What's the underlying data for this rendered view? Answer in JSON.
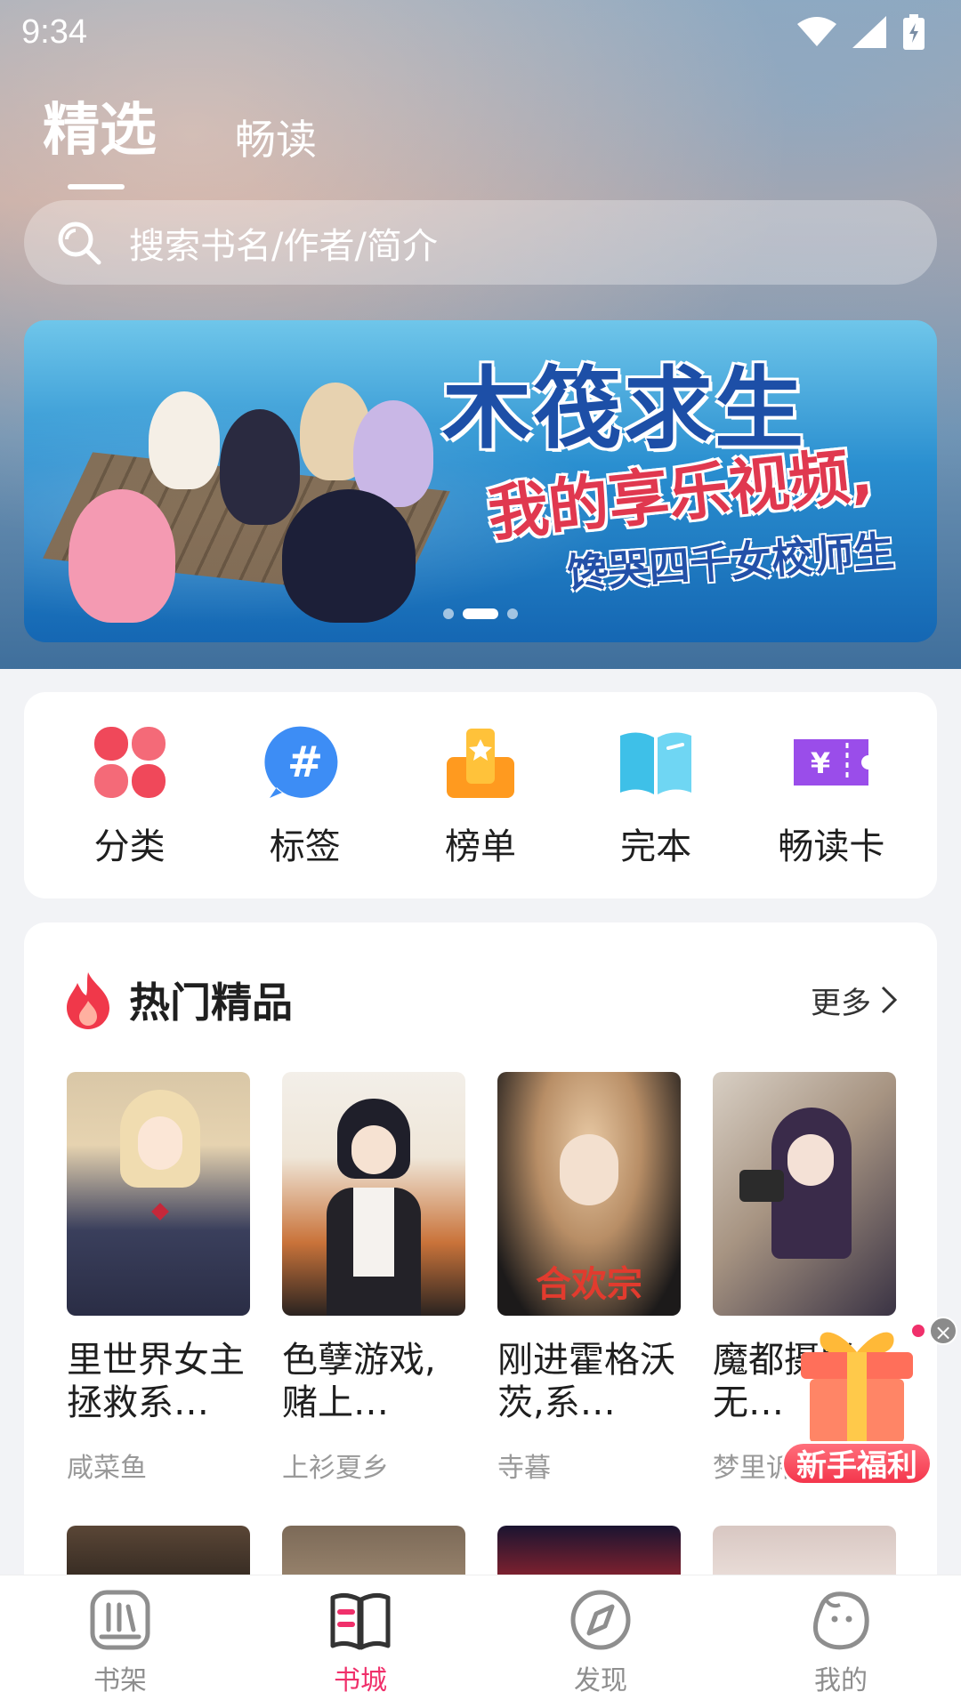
{
  "status_bar": {
    "time": "9:34"
  },
  "top_tabs": [
    {
      "label": "精选",
      "active": true
    },
    {
      "label": "畅读",
      "active": false
    }
  ],
  "search": {
    "placeholder": "搜索书名/作者/简介"
  },
  "banner": {
    "title": "木筏求生",
    "subtitle1": "我的享乐视频,",
    "subtitle2": "馋哭四千女校师生",
    "dots": 3,
    "active_dot": 1
  },
  "categories": [
    {
      "label": "分类",
      "icon": "grid-petal-icon",
      "color": "#f0485a"
    },
    {
      "label": "标签",
      "icon": "hashtag-icon",
      "color": "#3d8df5"
    },
    {
      "label": "榜单",
      "icon": "podium-icon",
      "color": "#ff9a1f"
    },
    {
      "label": "完本",
      "icon": "open-book-icon",
      "color": "#3ec0e8"
    },
    {
      "label": "畅读卡",
      "icon": "ticket-icon",
      "color": "#9a4dea"
    }
  ],
  "hot_section": {
    "title": "热门精品",
    "more_label": "更多",
    "books": [
      {
        "title": "里世界女主拯救系…",
        "author": "咸菜鱼"
      },
      {
        "title": "色孽游戏,赌上…",
        "author": "上衫夏乡"
      },
      {
        "title": "刚进霍格沃茨,系…",
        "author": "寺暮"
      },
      {
        "title": "魔都摄影,无…",
        "author": "梦里诉"
      }
    ]
  },
  "gift": {
    "label": "新手福利",
    "close": "×"
  },
  "bottom_nav": [
    {
      "label": "书架",
      "icon": "bookshelf-icon",
      "active": false
    },
    {
      "label": "书城",
      "icon": "bookstore-icon",
      "active": true
    },
    {
      "label": "发现",
      "icon": "compass-icon",
      "active": false
    },
    {
      "label": "我的",
      "icon": "profile-icon",
      "active": false
    }
  ],
  "colors": {
    "accent": "#f0306b",
    "nav_inactive": "#8e8e8e"
  }
}
